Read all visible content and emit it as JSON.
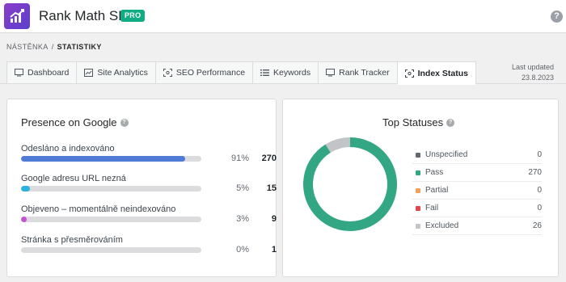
{
  "header": {
    "app_title": "Rank Math SEO",
    "badge": "PRO",
    "help": "?"
  },
  "breadcrumb": {
    "parent": "NÁSTĚNKA",
    "separator": "/",
    "current": "STATISTIKY"
  },
  "tabs": [
    {
      "label": "Dashboard",
      "icon": "dashboard-icon"
    },
    {
      "label": "Site Analytics",
      "icon": "analytics-icon"
    },
    {
      "label": "SEO Performance",
      "icon": "seo-performance-icon"
    },
    {
      "label": "Keywords",
      "icon": "keywords-icon"
    },
    {
      "label": "Rank Tracker",
      "icon": "rank-tracker-icon"
    },
    {
      "label": "Index Status",
      "icon": "index-status-icon",
      "active": true
    }
  ],
  "last_updated": {
    "label": "Last updated",
    "date": "23.8.2023"
  },
  "presence": {
    "title": "Presence on Google",
    "rows": [
      {
        "label": "Odesláno a indexováno",
        "percent_text": "91%",
        "fill": 0.91,
        "count": "270",
        "color": "#4f7ad6"
      },
      {
        "label": "Google adresu URL nezná",
        "percent_text": "5%",
        "fill": 0.05,
        "count": "15",
        "color": "#2eb2e0"
      },
      {
        "label": "Objeveno – momentálně neindexováno",
        "percent_text": "3%",
        "fill": 0.03,
        "count": "9",
        "color": "#c84fd8"
      },
      {
        "label": "Stránka s přesměrováním",
        "percent_text": "0%",
        "fill": 0,
        "count": "1",
        "color": "#4f7ad6"
      }
    ]
  },
  "top_statuses": {
    "title": "Top Statuses",
    "items": [
      {
        "name": "Unspecified",
        "count": "0",
        "color": "#646970"
      },
      {
        "name": "Pass",
        "count": "270",
        "color": "#33a783"
      },
      {
        "name": "Partial",
        "count": "0",
        "color": "#f0a25c"
      },
      {
        "name": "Fail",
        "count": "0",
        "color": "#e0484e"
      },
      {
        "name": "Excluded",
        "count": "26",
        "color": "#c3c4c7"
      }
    ]
  }
}
